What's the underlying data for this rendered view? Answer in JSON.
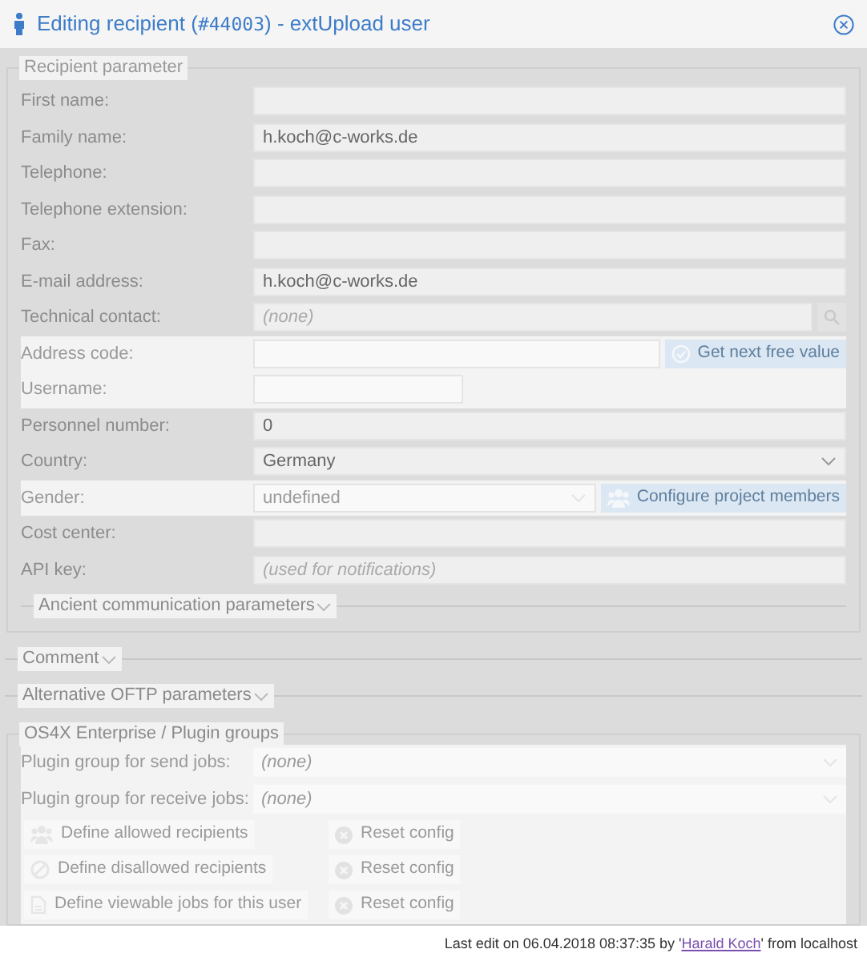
{
  "dialog": {
    "title_prefix": "Editing recipient (",
    "title_id": "#44003",
    "title_suffix": ") - extUpload user"
  },
  "recipient_parameter": {
    "legend": "Recipient parameter",
    "fields": [
      {
        "kind": "text",
        "label": "First name:",
        "disabled": false
      },
      {
        "kind": "text",
        "label": "Family name:",
        "value": "h.koch@c-works.de",
        "disabled": false
      },
      {
        "kind": "text",
        "label": "Telephone:",
        "disabled": false
      },
      {
        "kind": "text",
        "label": "Telephone extension:",
        "disabled": false
      },
      {
        "kind": "text",
        "label": "Fax:",
        "disabled": false
      },
      {
        "kind": "text",
        "label": "E-mail address:",
        "value": "h.koch@c-works.de",
        "disabled": false
      },
      {
        "kind": "search",
        "label": "Technical contact:",
        "placeholder": "(none)",
        "disabled": false
      },
      {
        "kind": "text",
        "label": "Address code:",
        "disabled": true,
        "button": "Get next free value"
      },
      {
        "kind": "short",
        "label": "Username:",
        "disabled": true
      },
      {
        "kind": "text",
        "label": "Personnel number:",
        "value": "0",
        "disabled": false
      },
      {
        "kind": "select",
        "label": "Country:",
        "value": "Germany",
        "disabled": false
      },
      {
        "kind": "select",
        "label": "Gender:",
        "value": "undefined",
        "disabled": true,
        "button": "Configure project members"
      },
      {
        "kind": "text",
        "label": "Cost center:",
        "disabled": false
      },
      {
        "kind": "text",
        "label": "API key:",
        "placeholder": "(used for notifications)",
        "disabled": false
      }
    ],
    "sub_section": {
      "label": "Ancient communication parameters",
      "expanded": false
    }
  },
  "sections": [
    {
      "label": "Comment",
      "expanded": false
    },
    {
      "label": "Alternative OFTP parameters",
      "expanded": false
    }
  ],
  "plugin_groups": {
    "legend": "OS4X Enterprise / Plugin groups",
    "disabled": true,
    "selects": [
      {
        "label": "Plugin group for send jobs:",
        "placeholder": "(none)"
      },
      {
        "label": "Plugin group for receive jobs:",
        "placeholder": "(none)"
      }
    ],
    "actions": [
      {
        "kind": "users",
        "label": "Define allowed recipients",
        "reset": "Reset config"
      },
      {
        "kind": "forbidden",
        "label": "Define disallowed recipients",
        "reset": "Reset config"
      },
      {
        "kind": "document",
        "label": "Define viewable jobs for this user",
        "reset": "Reset config"
      }
    ]
  },
  "footer": {
    "prefix": "Last edit on 06.04.2018 08:37:35 by '",
    "user": "Harald Koch",
    "suffix": "' from localhost"
  }
}
